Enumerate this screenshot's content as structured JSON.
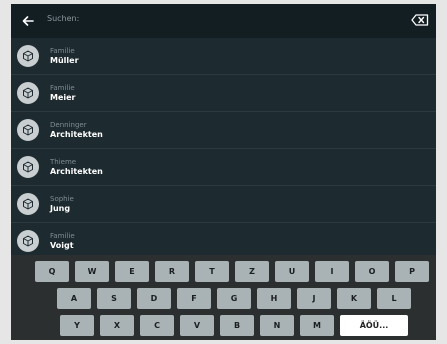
{
  "search": {
    "label": "Suchen:"
  },
  "contacts": [
    {
      "first": "Familie",
      "last": "Müller"
    },
    {
      "first": "Familie",
      "last": "Meier"
    },
    {
      "first": "Denninger",
      "last": "Architekten"
    },
    {
      "first": "Thieme",
      "last": "Architekten"
    },
    {
      "first": "Sophie",
      "last": "Jung"
    },
    {
      "first": "Familie",
      "last": "Voigt"
    }
  ],
  "keyboard": {
    "row1": [
      "Q",
      "W",
      "E",
      "R",
      "T",
      "Z",
      "U",
      "I",
      "O",
      "P"
    ],
    "row2": [
      "A",
      "S",
      "D",
      "F",
      "G",
      "H",
      "J",
      "K",
      "L"
    ],
    "row3": [
      "Y",
      "X",
      "C",
      "V",
      "B",
      "N",
      "M"
    ],
    "special_key": "ÄÖÜ..."
  },
  "colors": {
    "background": "#1d2a30",
    "search_bar": "#131e23",
    "keyboard": "#2c2f30",
    "key": "#a9b3b6",
    "special_key": "#ffffff"
  },
  "icons": {
    "back": "arrow-left-icon",
    "clear": "backspace-icon",
    "avatar": "cube-icon"
  }
}
